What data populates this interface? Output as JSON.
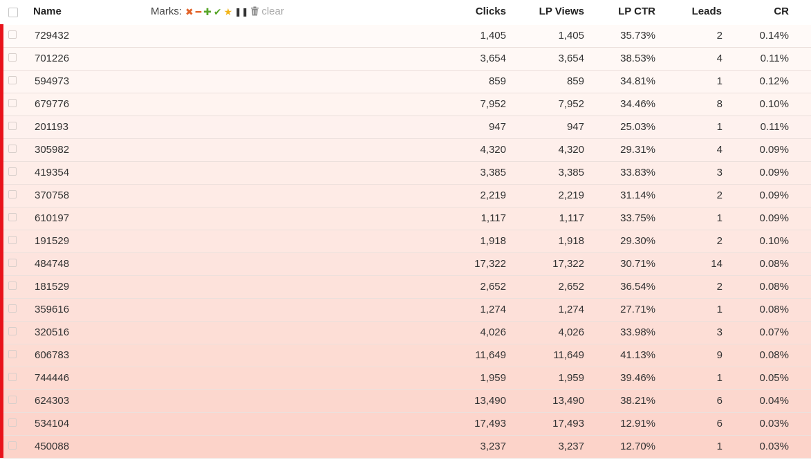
{
  "header": {
    "name": "Name",
    "marks_label": "Marks:",
    "marks_icons": [
      "x-icon",
      "minus-icon",
      "plus-icon",
      "check-icon",
      "star-icon",
      "pause-icon",
      "trash-icon"
    ],
    "clear": "clear",
    "clicks": "Clicks",
    "lp_views": "LP Views",
    "lp_ctr": "LP CTR",
    "leads": "Leads",
    "cr": "CR"
  },
  "colors": {
    "row_marker": "#e8121a",
    "gradient_top": "#fffaf8",
    "gradient_bottom": "#fcd3c9"
  },
  "rows": [
    {
      "name": "729432",
      "clicks": "1,405",
      "lp_views": "1,405",
      "lp_ctr": "35.73%",
      "leads": "2",
      "cr": "0.14%"
    },
    {
      "name": "701226",
      "clicks": "3,654",
      "lp_views": "3,654",
      "lp_ctr": "38.53%",
      "leads": "4",
      "cr": "0.11%"
    },
    {
      "name": "594973",
      "clicks": "859",
      "lp_views": "859",
      "lp_ctr": "34.81%",
      "leads": "1",
      "cr": "0.12%"
    },
    {
      "name": "679776",
      "clicks": "7,952",
      "lp_views": "7,952",
      "lp_ctr": "34.46%",
      "leads": "8",
      "cr": "0.10%"
    },
    {
      "name": "201193",
      "clicks": "947",
      "lp_views": "947",
      "lp_ctr": "25.03%",
      "leads": "1",
      "cr": "0.11%"
    },
    {
      "name": "305982",
      "clicks": "4,320",
      "lp_views": "4,320",
      "lp_ctr": "29.31%",
      "leads": "4",
      "cr": "0.09%"
    },
    {
      "name": "419354",
      "clicks": "3,385",
      "lp_views": "3,385",
      "lp_ctr": "33.83%",
      "leads": "3",
      "cr": "0.09%"
    },
    {
      "name": "370758",
      "clicks": "2,219",
      "lp_views": "2,219",
      "lp_ctr": "31.14%",
      "leads": "2",
      "cr": "0.09%"
    },
    {
      "name": "610197",
      "clicks": "1,117",
      "lp_views": "1,117",
      "lp_ctr": "33.75%",
      "leads": "1",
      "cr": "0.09%"
    },
    {
      "name": "191529",
      "clicks": "1,918",
      "lp_views": "1,918",
      "lp_ctr": "29.30%",
      "leads": "2",
      "cr": "0.10%"
    },
    {
      "name": "484748",
      "clicks": "17,322",
      "lp_views": "17,322",
      "lp_ctr": "30.71%",
      "leads": "14",
      "cr": "0.08%"
    },
    {
      "name": "181529",
      "clicks": "2,652",
      "lp_views": "2,652",
      "lp_ctr": "36.54%",
      "leads": "2",
      "cr": "0.08%"
    },
    {
      "name": "359616",
      "clicks": "1,274",
      "lp_views": "1,274",
      "lp_ctr": "27.71%",
      "leads": "1",
      "cr": "0.08%"
    },
    {
      "name": "320516",
      "clicks": "4,026",
      "lp_views": "4,026",
      "lp_ctr": "33.98%",
      "leads": "3",
      "cr": "0.07%"
    },
    {
      "name": "606783",
      "clicks": "11,649",
      "lp_views": "11,649",
      "lp_ctr": "41.13%",
      "leads": "9",
      "cr": "0.08%"
    },
    {
      "name": "744446",
      "clicks": "1,959",
      "lp_views": "1,959",
      "lp_ctr": "39.46%",
      "leads": "1",
      "cr": "0.05%"
    },
    {
      "name": "624303",
      "clicks": "13,490",
      "lp_views": "13,490",
      "lp_ctr": "38.21%",
      "leads": "6",
      "cr": "0.04%"
    },
    {
      "name": "534104",
      "clicks": "17,493",
      "lp_views": "17,493",
      "lp_ctr": "12.91%",
      "leads": "6",
      "cr": "0.03%"
    },
    {
      "name": "450088",
      "clicks": "3,237",
      "lp_views": "3,237",
      "lp_ctr": "12.70%",
      "leads": "1",
      "cr": "0.03%"
    }
  ]
}
